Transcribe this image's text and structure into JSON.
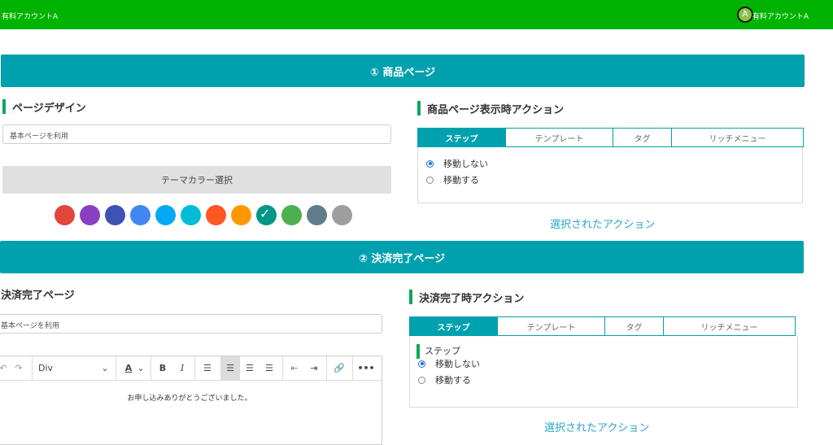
{
  "header": {
    "account_left": "有料アカウントA",
    "avatar_letter": "A",
    "account_right": "有料アカウントA"
  },
  "section1": {
    "title": "① 商品ページ",
    "page_design_heading": "ページデザイン",
    "page_design_value": "基本ページを利用",
    "theme_color_label": "テーマカラー選択",
    "theme_colors": [
      "#e0463b",
      "#8a3ec2",
      "#3f51b5",
      "#4285f4",
      "#03a9f4",
      "#00bcd4",
      "#ff5722",
      "#ff9800",
      "#009688",
      "#4caf50",
      "#607d8b",
      "#9e9e9e"
    ],
    "selected_color_index": 8,
    "action_heading": "商品ページ表示時アクション",
    "tabs": [
      "ステップ",
      "テンプレート",
      "タグ",
      "リッチメニュー"
    ],
    "active_tab": 0,
    "options": [
      "移動しない",
      "移動する"
    ],
    "selected_option": 0,
    "selected_action_label": "選択されたアクション"
  },
  "section2": {
    "title": "② 決済完了ページ",
    "page_heading": "決済完了ページ",
    "page_value": "基本ページを利用",
    "editor": {
      "block_format": "Div",
      "body_text": "お申し込みありがとうございました。"
    },
    "action_heading": "決済完了時アクション",
    "tabs": [
      "ステップ",
      "テンプレート",
      "タグ",
      "リッチメニュー"
    ],
    "active_tab": 0,
    "subheading": "ステップ",
    "options": [
      "移動しない",
      "移動する"
    ],
    "selected_option": 0,
    "selected_action_label": "選択されたアクション"
  },
  "colors": {
    "header_green": "#00b300",
    "teal": "#00a1ae",
    "accent_green": "#0ca85a"
  }
}
